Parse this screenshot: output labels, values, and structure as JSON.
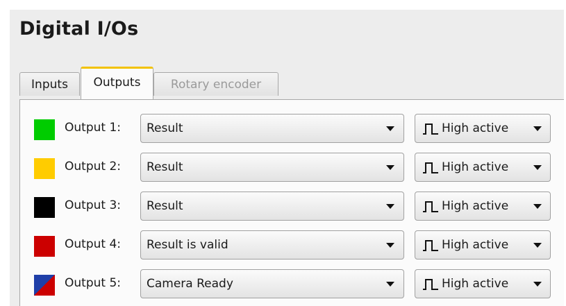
{
  "header": {
    "title": "Digital I/Os"
  },
  "tabs": [
    {
      "label": "Inputs",
      "state": "normal"
    },
    {
      "label": "Outputs",
      "state": "active"
    },
    {
      "label": "Rotary encoder",
      "state": "disabled"
    }
  ],
  "outputs": [
    {
      "label": "Output 1:",
      "color": "#00cc00",
      "signal": "Result",
      "mode": "High active",
      "mode_icon": "pulse-icon"
    },
    {
      "label": "Output 2:",
      "color": "#ffcc00",
      "signal": "Result",
      "mode": "High active",
      "mode_icon": "pulse-icon"
    },
    {
      "label": "Output 3:",
      "color": "#000000",
      "signal": "Result",
      "mode": "High active",
      "mode_icon": "pulse-icon"
    },
    {
      "label": "Output 4:",
      "color": "#cc0000",
      "signal": "Result is valid",
      "mode": "High active",
      "mode_icon": "pulse-icon"
    },
    {
      "label": "Output 5:",
      "color": [
        "#1f3fa8",
        "#cc0000"
      ],
      "signal": "Camera Ready",
      "mode": "High active",
      "mode_icon": "pulse-icon"
    }
  ]
}
